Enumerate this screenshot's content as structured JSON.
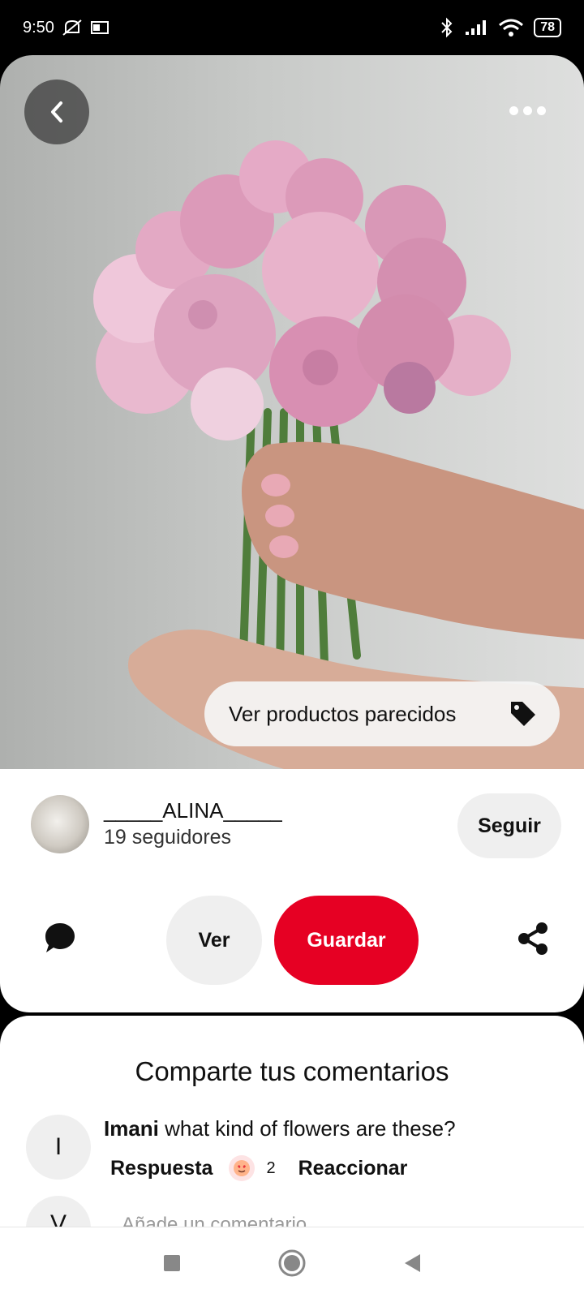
{
  "status_bar": {
    "time": "9:50",
    "left_icons": [
      "mute-icon",
      "outlook-icon"
    ],
    "right_icons": [
      "bluetooth-icon",
      "signal-icon",
      "wifi-icon"
    ],
    "battery": "78"
  },
  "pin": {
    "image_description": "pink-peony-bouquet",
    "similar_products_label": "Ver productos parecidos",
    "author": {
      "name": "_____ALINA_____",
      "followers": "19 seguidores"
    },
    "follow_label": "Seguir",
    "view_label": "Ver",
    "save_label": "Guardar"
  },
  "comments": {
    "title": "Comparte tus comentarios",
    "items": [
      {
        "avatar_letter": "I",
        "author": "Imani",
        "text": "what kind of flowers are these?",
        "reply_label": "Respuesta",
        "reaction_count": "2",
        "react_label": "Reaccionar"
      }
    ],
    "next_avatar_letter": "V",
    "add_placeholder": "Añade un comentario"
  },
  "colors": {
    "accent": "#e60023",
    "pill_bg": "#efefef"
  }
}
